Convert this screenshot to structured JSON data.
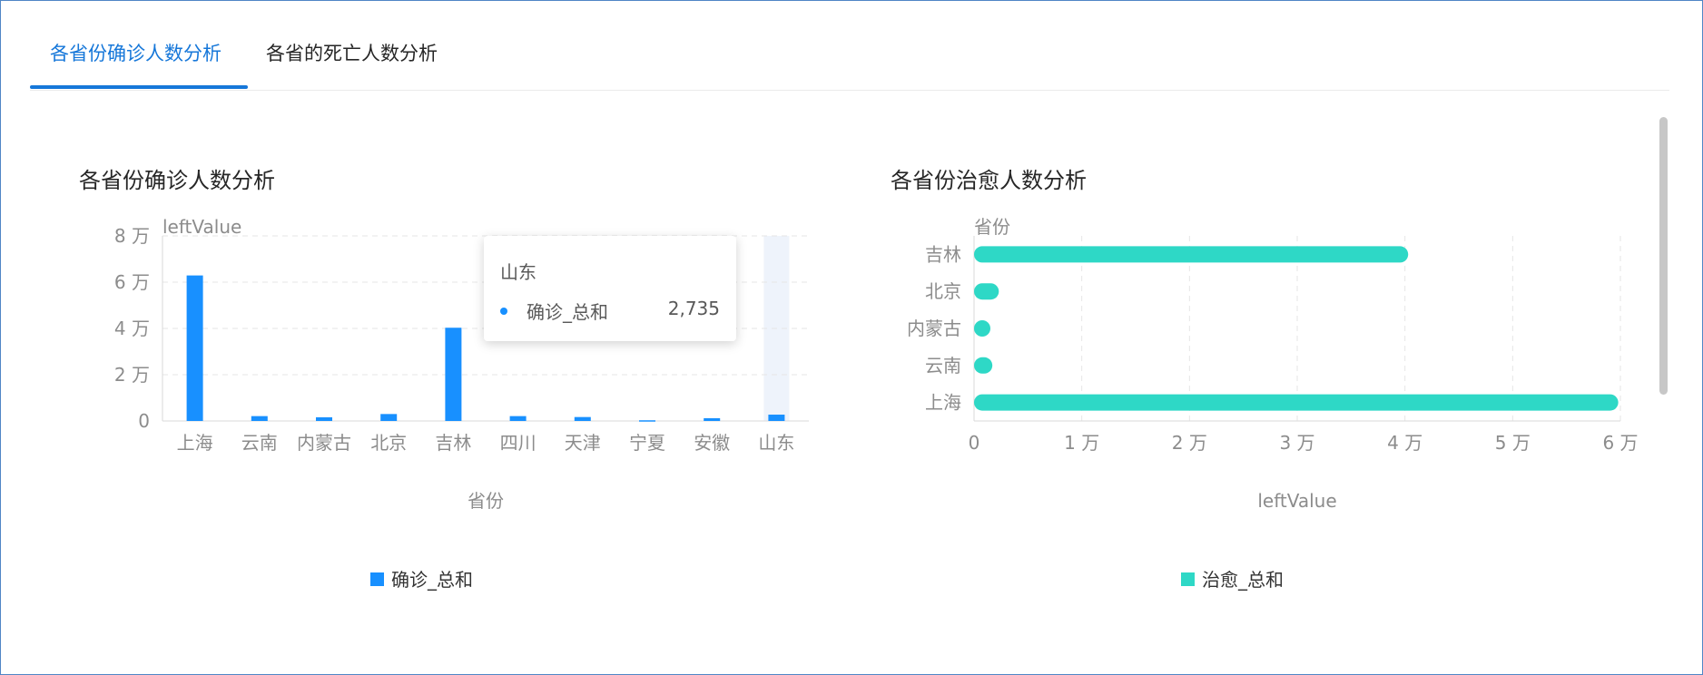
{
  "tabs": [
    {
      "label": "各省份确诊人数分析",
      "active": true
    },
    {
      "label": "各省的死亡人数分析",
      "active": false
    }
  ],
  "chart_data": [
    {
      "type": "bar",
      "title": "各省份确诊人数分析",
      "xlabel": "省份",
      "ylabel": "leftValue",
      "categories": [
        "上海",
        "云南",
        "内蒙古",
        "北京",
        "吉林",
        "四川",
        "天津",
        "宁夏",
        "安徽",
        "山东"
      ],
      "series": [
        {
          "name": "确诊_总和",
          "color": "#1890ff",
          "values": [
            62900,
            2100,
            1600,
            3000,
            40300,
            2100,
            1700,
            300,
            1200,
            2735
          ]
        }
      ],
      "ylim": [
        0,
        80000
      ],
      "yticks": [
        {
          "value": 0,
          "label": "0"
        },
        {
          "value": 20000,
          "label": "2 万"
        },
        {
          "value": 40000,
          "label": "4 万"
        },
        {
          "value": 60000,
          "label": "6 万"
        },
        {
          "value": 80000,
          "label": "8 万"
        }
      ],
      "highlighted_category": "山东",
      "legend": "bottom",
      "grid": true,
      "tooltip": {
        "title": "山东",
        "series_name": "确诊_总和",
        "value": "2,735"
      }
    },
    {
      "type": "bar",
      "orientation": "horizontal",
      "title": "各省份治愈人数分析",
      "xlabel": "leftValue",
      "ylabel": "省份",
      "categories": [
        "吉林",
        "北京",
        "内蒙古",
        "云南",
        "上海"
      ],
      "series": [
        {
          "name": "治愈_总和",
          "color": "#2ed8c6",
          "values": [
            40300,
            2300,
            1300,
            1700,
            59800
          ]
        }
      ],
      "xlim": [
        0,
        60000
      ],
      "xticks": [
        {
          "value": 0,
          "label": "0"
        },
        {
          "value": 10000,
          "label": "1 万"
        },
        {
          "value": 20000,
          "label": "2 万"
        },
        {
          "value": 30000,
          "label": "3 万"
        },
        {
          "value": 40000,
          "label": "4 万"
        },
        {
          "value": 50000,
          "label": "5 万"
        },
        {
          "value": 60000,
          "label": "6 万"
        }
      ],
      "legend": "bottom",
      "grid": true
    }
  ]
}
